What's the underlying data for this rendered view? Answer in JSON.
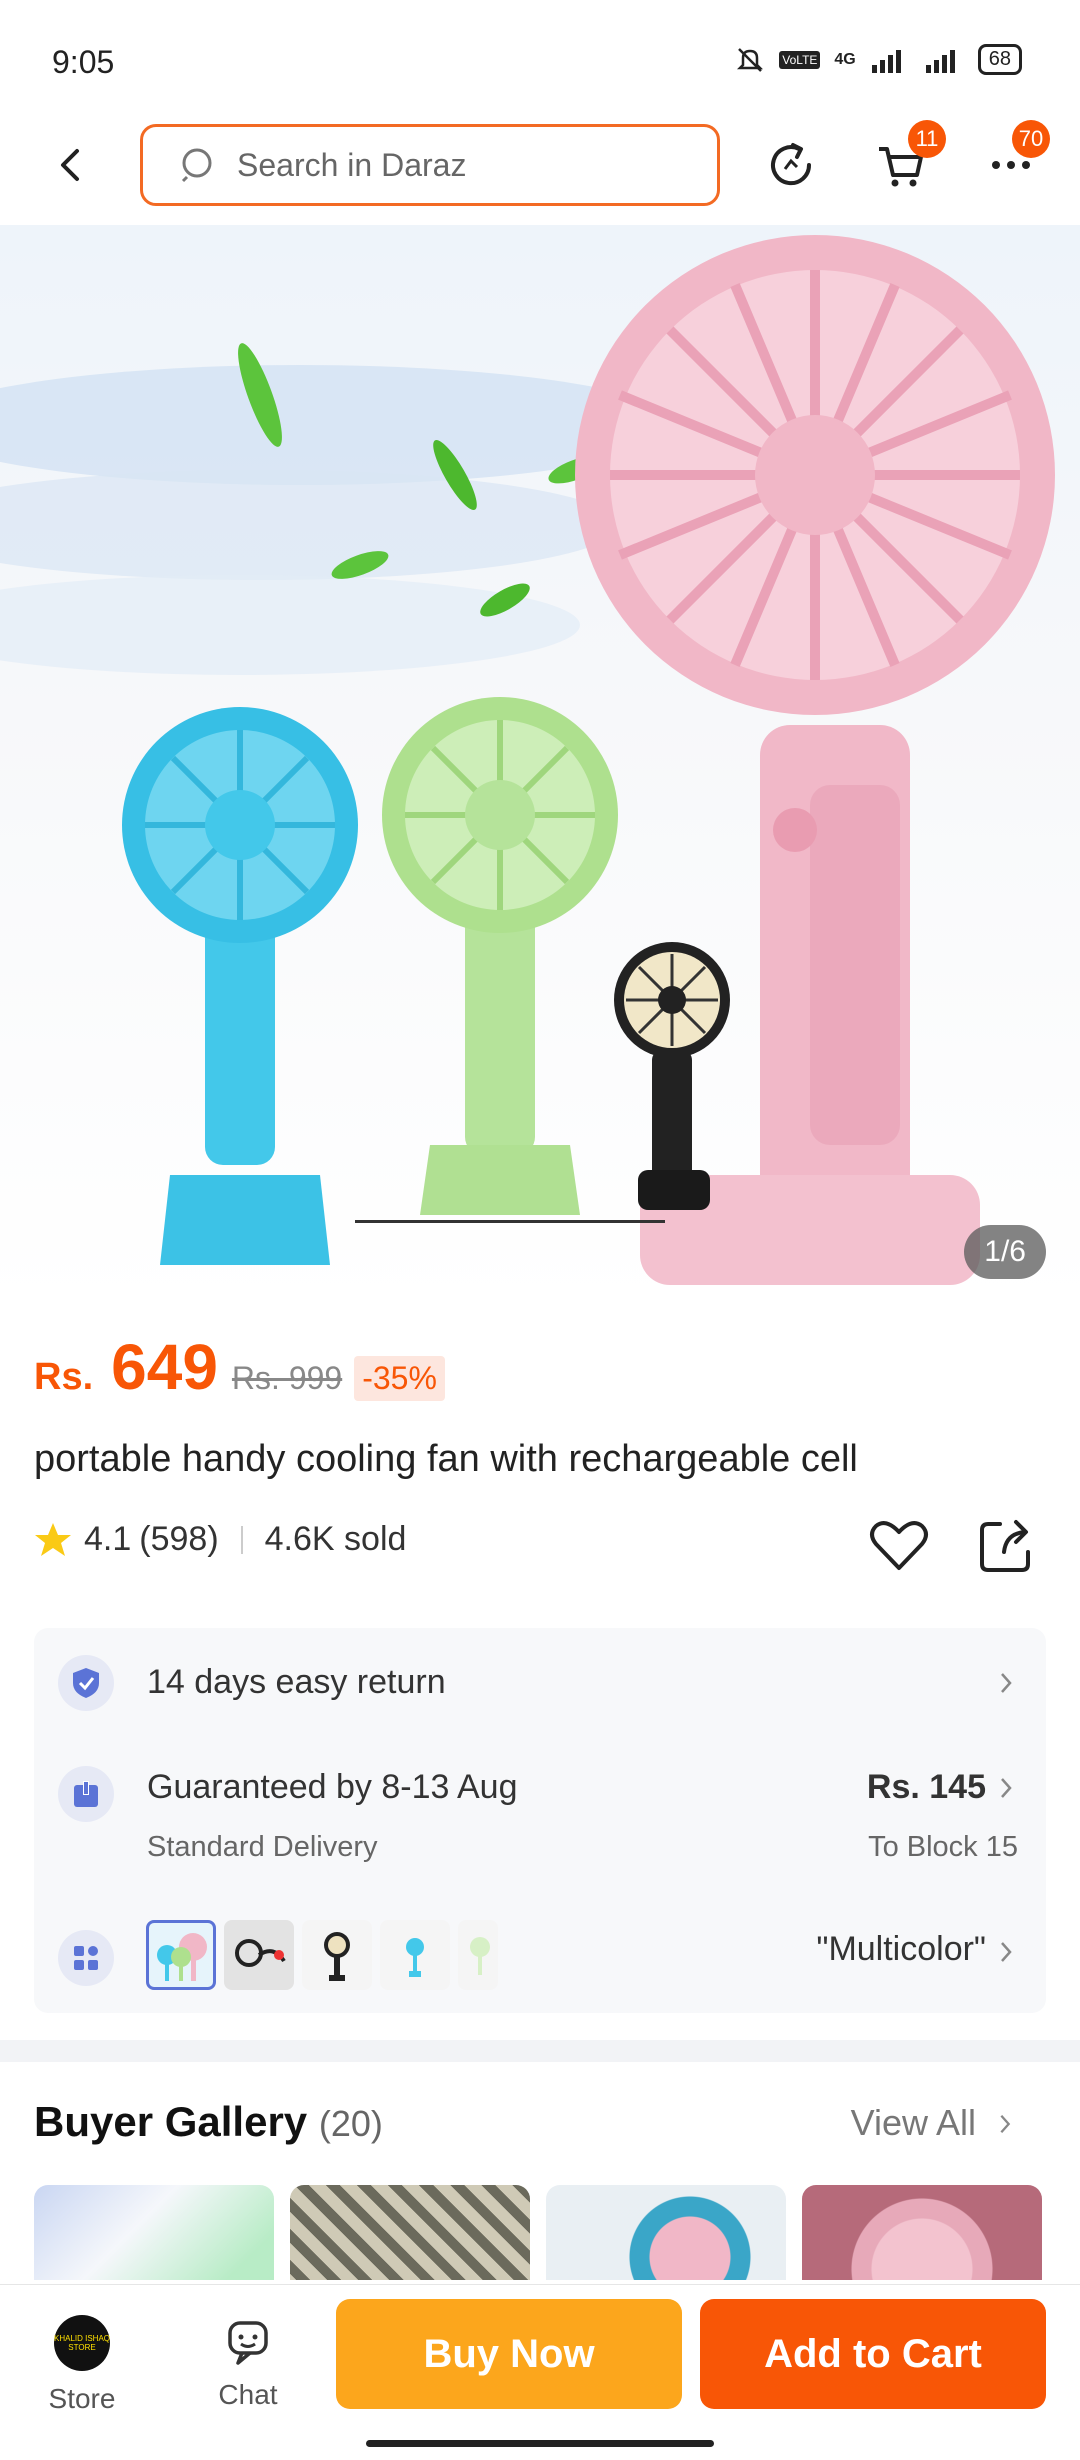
{
  "status_bar": {
    "time": "9:05",
    "network": "4G",
    "battery": "68"
  },
  "search": {
    "placeholder": "Search in Daraz"
  },
  "nav": {
    "cart_badge": "11",
    "more_badge": "70"
  },
  "hero": {
    "counter": "1/6"
  },
  "product": {
    "currency": "Rs.",
    "price": "649",
    "old_price": "Rs. 999",
    "discount": "-35%",
    "title": "portable handy cooling fan with rechargeable cell",
    "rating": "4.1",
    "reviews": "(598)",
    "sold": "4.6K sold"
  },
  "services": {
    "return_text": "14 days easy return",
    "delivery_title": "Guaranteed by 8-13 Aug",
    "delivery_sub": "Standard Delivery",
    "delivery_price": "Rs. 145",
    "delivery_to": "To Block 15",
    "variant_value": "\"Multicolor\""
  },
  "gallery": {
    "title": "Buyer Gallery",
    "count": "(20)",
    "view_all": "View All"
  },
  "bottom_bar": {
    "store_label": "Store",
    "store_logo_text": "KHALID ISHAQ STORE",
    "chat_label": "Chat",
    "buy_now": "Buy Now",
    "add_to_cart": "Add to Cart"
  },
  "colors": {
    "accent": "#f85606",
    "buy_now": "#fca61c",
    "search_border": "#f36a23"
  },
  "icons": [
    "back-arrow-icon",
    "search-icon",
    "refresh-icon",
    "cart-icon",
    "more-icon",
    "star-icon",
    "heart-icon",
    "share-icon",
    "shield-check-icon",
    "package-icon",
    "grid-icon",
    "chevron-right-icon",
    "store-icon",
    "chat-icon"
  ]
}
